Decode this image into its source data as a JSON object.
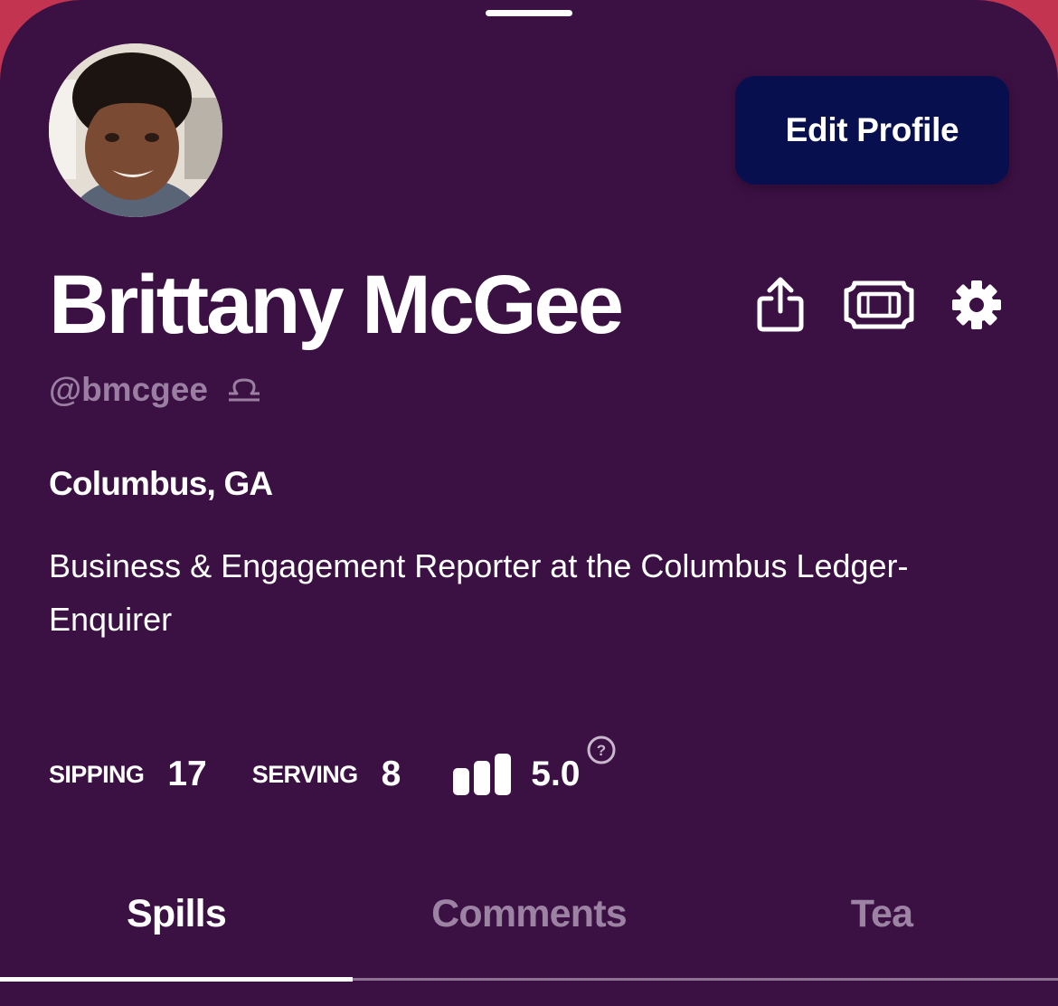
{
  "profile": {
    "name": "Brittany McGee",
    "handle": "@bmcgee",
    "location": "Columbus, GA",
    "bio": "Business & Engagement Reporter at the Columbus Ledger-Enquirer",
    "avatar_icon": "user-photo",
    "zodiac_icon": "libra-icon"
  },
  "actions": {
    "edit_profile_label": "Edit Profile",
    "icons": [
      "share-icon",
      "ticket-icon",
      "gear-icon"
    ]
  },
  "stats": {
    "sipping_label": "SIPPING",
    "sipping_value": "17",
    "serving_label": "SERVING",
    "serving_value": "8",
    "rating_icon": "bars-icon",
    "rating_value": "5.0",
    "help_icon": "question-circle-icon"
  },
  "tabs": [
    {
      "label": "Spills",
      "active": true
    },
    {
      "label": "Comments",
      "active": false
    },
    {
      "label": "Tea",
      "active": false
    }
  ],
  "colors": {
    "background": "#3b1043",
    "outer": "#c2344f",
    "button": "#070f4f",
    "muted_text": "#9a7fa2"
  }
}
